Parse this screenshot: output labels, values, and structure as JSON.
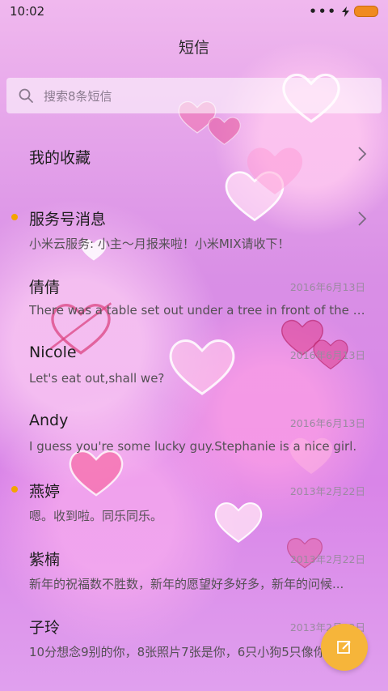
{
  "status_bar": {
    "time": "10:02",
    "dots": "•••",
    "icons": [
      "bolt-icon",
      "battery-icon"
    ]
  },
  "header": {
    "title": "短信"
  },
  "search": {
    "placeholder": "搜索8条短信"
  },
  "conversations": [
    {
      "name": "我的收藏",
      "preview": "",
      "date": "",
      "unread": false,
      "chevron": true
    },
    {
      "name": "服务号消息",
      "preview": "小米云服务: 小主～月报来啦！小米MIX请收下！",
      "date": "",
      "unread": true,
      "chevron": true
    },
    {
      "name": "倩倩",
      "preview": "There was a table set out under a tree in front of the ho...",
      "date": "2016年6月13日",
      "unread": false,
      "chevron": false
    },
    {
      "name": "Nicole",
      "preview": "Let's eat out,shall we?",
      "date": "2016年6月13日",
      "unread": false,
      "chevron": false
    },
    {
      "name": "Andy",
      "preview": "I guess you're some lucky guy.Stephanie is a nice girl.",
      "date": "2016年6月13日",
      "unread": false,
      "chevron": false
    },
    {
      "name": "燕婷",
      "preview": "嗯。收到啦。同乐同乐。",
      "date": "2013年2月22日",
      "unread": true,
      "chevron": false
    },
    {
      "name": "紫楠",
      "preview": "新年的祝福数不胜数，新年的愿望好多好多，新年的问候...",
      "date": "2013年2月22日",
      "unread": false,
      "chevron": false
    },
    {
      "name": "子玲",
      "preview": "10分想念9别的你，8张照片7张是你，6只小狗5只像你...",
      "date": "2013年2月22日",
      "unread": false,
      "chevron": false
    }
  ],
  "fab": {
    "icon": "compose-icon"
  },
  "colors": {
    "accent": "#f6b53a",
    "unread_dot": "#f4a400",
    "battery": "#f08a20"
  }
}
